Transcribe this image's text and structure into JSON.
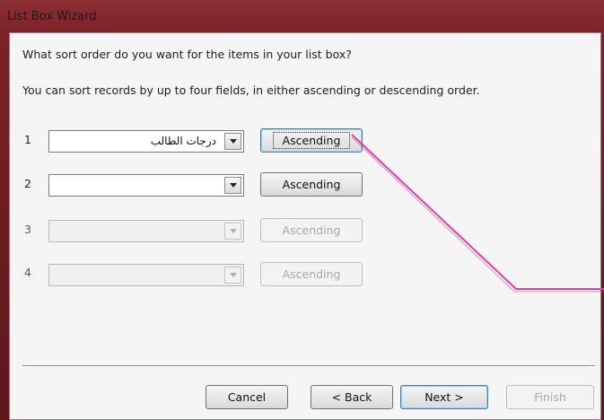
{
  "window": {
    "title": "List Box Wizard"
  },
  "prompts": {
    "question": "What sort order do you want for the items in your list box?",
    "instruction": "You can sort records by up to four fields, in either ascending or descending order."
  },
  "sort_rows": [
    {
      "number": "1",
      "field_value": "درجات الطالب",
      "order_label": "Ascending",
      "enabled": true
    },
    {
      "number": "2",
      "field_value": "",
      "order_label": "Ascending",
      "enabled": true
    },
    {
      "number": "3",
      "field_value": "",
      "order_label": "Ascending",
      "enabled": false
    },
    {
      "number": "4",
      "field_value": "",
      "order_label": "Ascending",
      "enabled": false
    }
  ],
  "buttons": {
    "cancel": "Cancel",
    "back": "< Back",
    "next": "Next >",
    "finish": "Finish"
  },
  "colors": {
    "annotation_line": "#e040a0",
    "desktop_background": "#6e1d22"
  }
}
